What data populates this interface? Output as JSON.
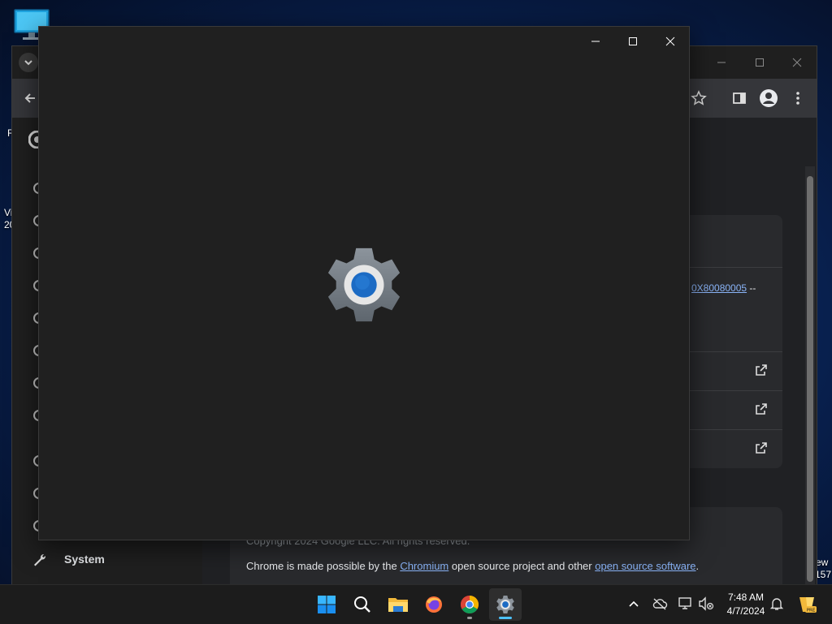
{
  "desktop": {
    "left_label_1": "R",
    "left_label_2": "Vi",
    "left_label_3": "20",
    "right_label_1": "ew",
    "right_label_2": "157"
  },
  "chrome": {
    "sidebar_item_system": "System",
    "error_code_link": "0X80080005",
    "error_suffix": "--",
    "copyright": "Copyright 2024 Google LLC. All rights reserved.",
    "credits_prefix": "Chrome is made possible by the ",
    "credits_chromium": "Chromium",
    "credits_middle": " open source project and other ",
    "credits_oss": "open source software",
    "credits_suffix": "."
  },
  "settings_window": {
    "app_icon": "settings-gear-icon",
    "controls": [
      "minimize-icon",
      "maximize-icon",
      "close-icon"
    ]
  },
  "taskbar": {
    "apps": [
      {
        "name": "start",
        "icon": "windows-logo-icon"
      },
      {
        "name": "search",
        "icon": "search-icon"
      },
      {
        "name": "file-explorer",
        "icon": "folder-icon"
      },
      {
        "name": "firefox",
        "icon": "firefox-icon"
      },
      {
        "name": "chrome",
        "icon": "chrome-icon"
      },
      {
        "name": "settings",
        "icon": "settings-icon"
      }
    ],
    "clock": {
      "time": "7:48 AM",
      "date": "4/7/2024"
    },
    "colors": {
      "accent": "#4cc2ff",
      "taskbar_bg": "#1c1c1c"
    }
  }
}
